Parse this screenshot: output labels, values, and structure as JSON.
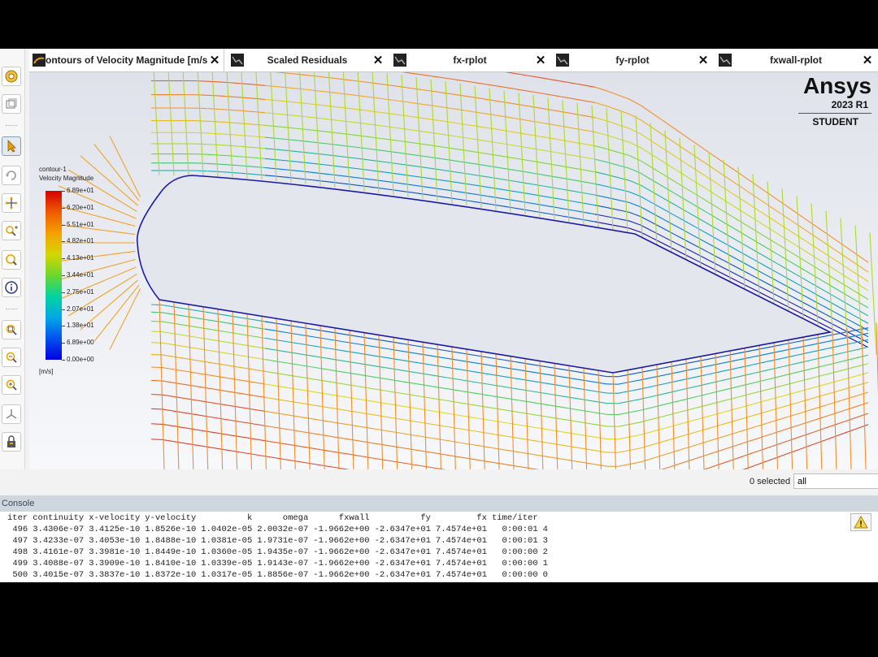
{
  "tabs": [
    {
      "label": "ontours of Velocity Magnitude [m/s",
      "close": "✕",
      "active": true
    },
    {
      "label": "Scaled Residuals",
      "close": "✕",
      "active": false
    },
    {
      "label": "fx-rplot",
      "close": "✕",
      "active": false
    },
    {
      "label": "fy-rplot",
      "close": "✕",
      "active": false
    },
    {
      "label": "fxwall-rplot",
      "close": "✕",
      "active": false
    }
  ],
  "toolbar": {
    "icons": [
      "orient-icon",
      "fit-icon",
      "select-arrow-icon",
      "rotate-icon",
      "pan-icon",
      "zoom-in-out-icon",
      "zoom-icon",
      "info-icon",
      "zoom-box-icon",
      "zoom-fit-icon",
      "zoom-view-icon",
      "axes-icon",
      "lock-icon"
    ]
  },
  "legend": {
    "title": "contour-1",
    "subtitle": "Velocity Magnitude",
    "units": "[m/s]",
    "labels": [
      "6.89e+01",
      "6.20e+01",
      "5.51e+01",
      "4.82e+01",
      "4.13e+01",
      "3.44e+01",
      "2.75e+01",
      "2.07e+01",
      "1.38e+01",
      "6.89e+00",
      "0.00e+00"
    ],
    "colors": {
      "max": "#d40000",
      "min": "#0000e0"
    }
  },
  "logo": {
    "name": "Ansys",
    "version": "2023 R1",
    "edition": "STUDENT"
  },
  "selection": {
    "count_text": "0 selected",
    "filter_value": "all"
  },
  "console": {
    "title": "Console",
    "columns": [
      "iter",
      "continuity",
      "x-velocity",
      "y-velocity",
      "k",
      "omega",
      "fxwall",
      "fy",
      "fx",
      "time/iter",
      ""
    ],
    "rows": [
      [
        "496",
        "3.4306e-07",
        "3.4125e-10",
        "1.8526e-10",
        "1.0402e-05",
        "2.0032e-07",
        "-1.9662e+00",
        "-2.6347e+01",
        "7.4574e+01",
        "0:00:01",
        "4"
      ],
      [
        "497",
        "3.4233e-07",
        "3.4053e-10",
        "1.8488e-10",
        "1.0381e-05",
        "1.9731e-07",
        "-1.9662e+00",
        "-2.6347e+01",
        "7.4574e+01",
        "0:00:01",
        "3"
      ],
      [
        "498",
        "3.4161e-07",
        "3.3981e-10",
        "1.8449e-10",
        "1.0360e-05",
        "1.9435e-07",
        "-1.9662e+00",
        "-2.6347e+01",
        "7.4574e+01",
        "0:00:00",
        "2"
      ],
      [
        "499",
        "3.4088e-07",
        "3.3909e-10",
        "1.8410e-10",
        "1.0339e-05",
        "1.9143e-07",
        "-1.9662e+00",
        "-2.6347e+01",
        "7.4574e+01",
        "0:00:00",
        "1"
      ],
      [
        "500",
        "3.4015e-07",
        "3.3837e-10",
        "1.8372e-10",
        "1.0317e-05",
        "1.8856e-07",
        "-1.9662e+00",
        "-2.6347e+01",
        "7.4574e+01",
        "0:00:00",
        "0"
      ]
    ],
    "warning_icon": "warning-icon"
  },
  "colors": {
    "accent": "#2b3a8f",
    "mesh_hot": "#e8502a",
    "mesh_wall": "#1a1aa8"
  }
}
